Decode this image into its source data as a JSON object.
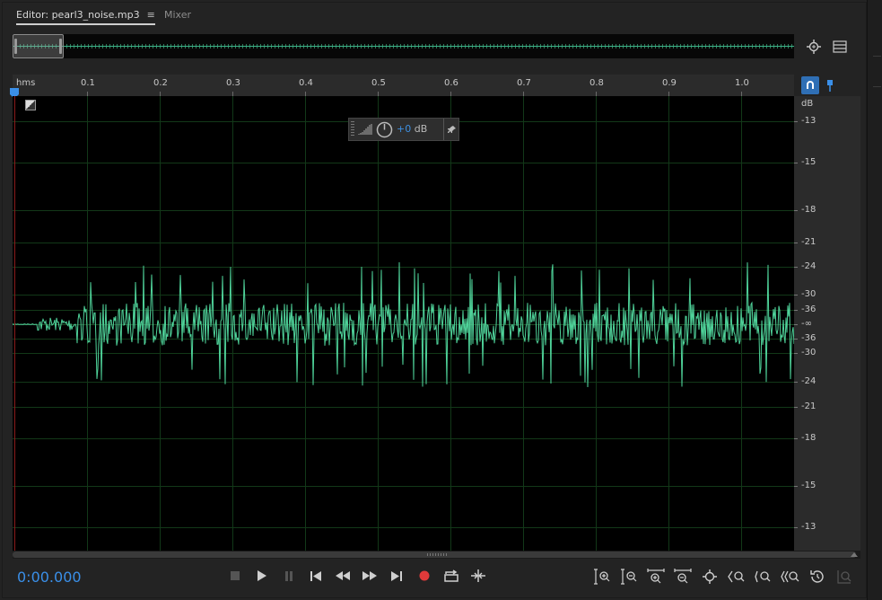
{
  "tabs": {
    "editor_label": "Editor: pearl3_noise.mp3",
    "editor_menu": "≡",
    "mixer_label": "Mixer"
  },
  "ruler": {
    "unit": "hms",
    "labels": [
      "0.1",
      "0.2",
      "0.3",
      "0.4",
      "0.5",
      "0.6",
      "0.7",
      "0.8",
      "0.9",
      "1.0"
    ]
  },
  "db_scale": {
    "unit": "dB",
    "labels": [
      "-13",
      "-15",
      "-18",
      "-21",
      "-24",
      "-30",
      "-36",
      "-∞",
      "-36",
      "-30",
      "-24",
      "-21",
      "-18",
      "-15",
      "-13"
    ]
  },
  "hud": {
    "gain_value": "+0",
    "gain_unit": " dB"
  },
  "transport": {
    "time": "0:00.000"
  },
  "colors": {
    "waveform": "#4fd39a",
    "accent": "#3a8fe8",
    "record": "#e03a3a"
  },
  "icons": {
    "overview": [
      "zoom-to-selection-icon",
      "panel-menu-icon"
    ],
    "transport": [
      "stop-icon",
      "play-icon",
      "pause-icon",
      "go-to-start-icon",
      "rewind-icon",
      "fast-forward-icon",
      "go-to-end-icon",
      "record-icon",
      "loop-icon",
      "skip-selection-icon"
    ],
    "zoom": [
      "zoom-in-amplitude-icon",
      "zoom-out-amplitude-icon",
      "zoom-in-time-icon",
      "zoom-out-time-icon",
      "zoom-out-full-icon",
      "zoom-in-left-icon",
      "zoom-in-right-icon",
      "zoom-selection-icon",
      "zoom-reset-icon",
      "zoom-disabled-icon"
    ]
  }
}
